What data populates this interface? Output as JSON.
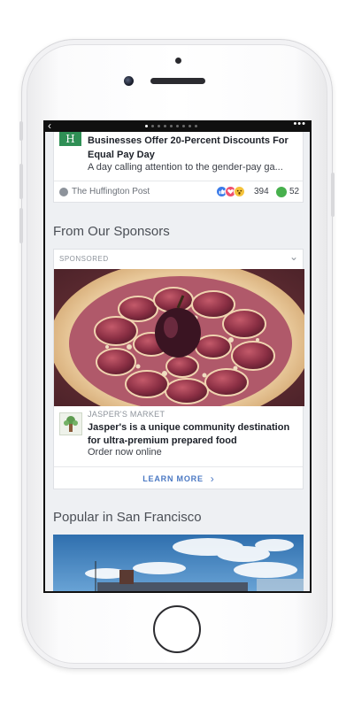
{
  "article": {
    "title": "Businesses Offer 20-Percent Discounts For Equal Pay Day",
    "subtitle": "A day calling attention to the gender-pay ga...",
    "source": "The Huffington Post",
    "reaction_count": "394",
    "comment_count": "52"
  },
  "sections": {
    "sponsors_heading": "From Our Sponsors",
    "popular_heading": "Popular in San Francisco"
  },
  "sponsored": {
    "label": "SPONSORED",
    "advertiser": "JASPER'S MARKET",
    "headline": "Jasper's is a unique community destination for ultra-premium prepared food",
    "subtext": "Order now online",
    "cta": "LEARN MORE"
  },
  "icons": {
    "back": "chevron-left-icon",
    "more": "more-horizontal-icon",
    "collapse": "chevron-down-icon",
    "cta_arrow": "chevron-right-icon"
  },
  "colors": {
    "accent": "#4a78c3",
    "publisher_logo": "#2f8f55",
    "like": "#3b7be9",
    "love": "#f0506e",
    "wow": "#f5c33b",
    "comment": "#47b04d"
  }
}
